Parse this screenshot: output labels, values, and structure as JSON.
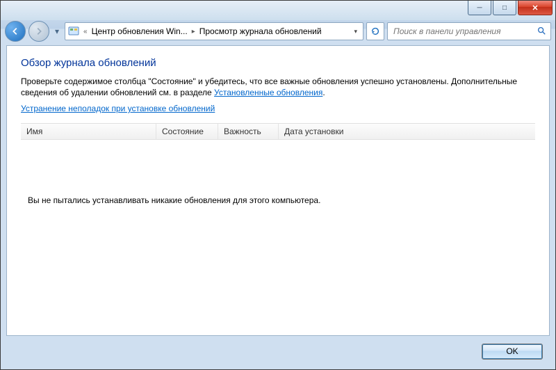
{
  "breadcrumb": {
    "item1": "Центр обновления Win...",
    "item2": "Просмотр журнала обновлений"
  },
  "search": {
    "placeholder": "Поиск в панели управления"
  },
  "page": {
    "title": "Обзор журнала обновлений",
    "desc_before": "Проверьте содержимое столбца \"Состояние\" и убедитесь, что все важные обновления успешно установлены. Дополнительные сведения об удалении обновлений см. в разделе ",
    "desc_link": "Установленные обновления",
    "desc_after": ".",
    "troubleshoot": "Устранение неполадок при установке обновлений"
  },
  "columns": {
    "name": "Имя",
    "status": "Состояние",
    "importance": "Важность",
    "date": "Дата установки"
  },
  "empty_message": "Вы не пытались устанавливать никакие обновления для этого компьютера.",
  "buttons": {
    "ok": "OK"
  }
}
